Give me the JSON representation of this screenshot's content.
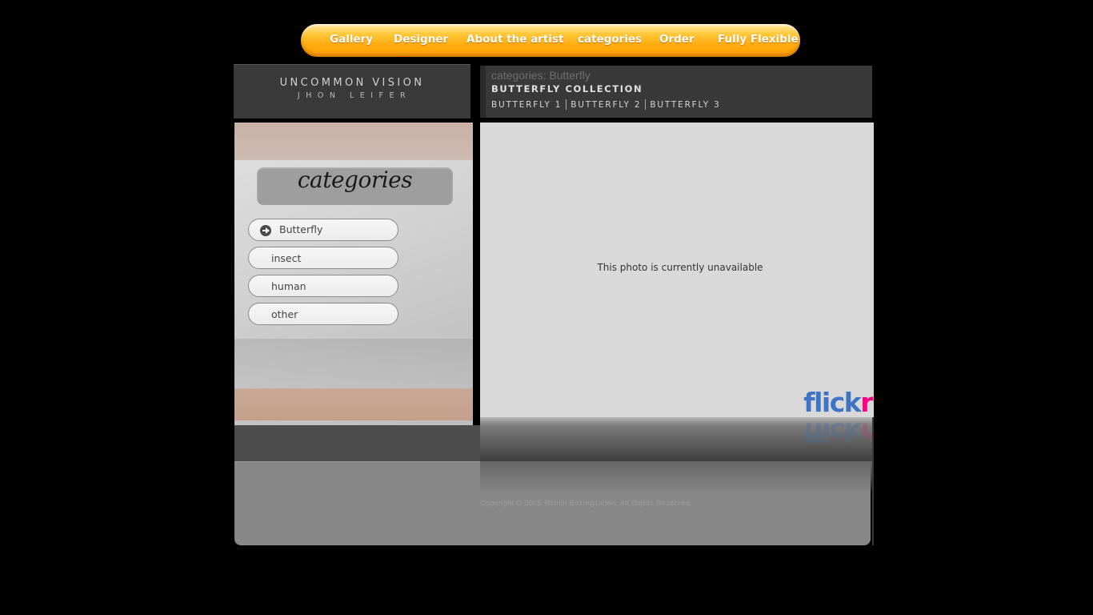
{
  "nav": {
    "items": [
      {
        "label": "Gallery"
      },
      {
        "label": "Designer"
      },
      {
        "label": "About the artist"
      },
      {
        "label": "categories"
      },
      {
        "label": "Order"
      },
      {
        "label": "Fully Flexible"
      }
    ]
  },
  "brand": {
    "title": "UNCOMMON VISION",
    "subtitle": "JHON LEIFER"
  },
  "info": {
    "breadcrumb": "categories: Butterfly",
    "collection_title": "BUTTERFLY COLLECTION",
    "subnav": [
      {
        "label": "BUTTERFLY 1"
      },
      {
        "label": "BUTTERFLY 2"
      },
      {
        "label": "BUTTERFLY 3"
      }
    ]
  },
  "sidebar": {
    "heading": "categories",
    "items": [
      {
        "label": "Butterfly",
        "active": true
      },
      {
        "label": "insect"
      },
      {
        "label": "human"
      },
      {
        "label": "other"
      }
    ]
  },
  "photo": {
    "message": "This photo is currently unavailable",
    "logo_left": "flick",
    "logo_right": "r"
  },
  "footer": {
    "copyright": "Copyright © 2005 Ramin Bozorgzadeh. All Rights Reserved."
  },
  "colors": {
    "nav_orange": "#ffae12",
    "panel_dark": "#3a3a3a",
    "photo_bg": "#d9d9d9",
    "flickr_blue": "#3f74c4",
    "flickr_pink": "#ff0084"
  }
}
